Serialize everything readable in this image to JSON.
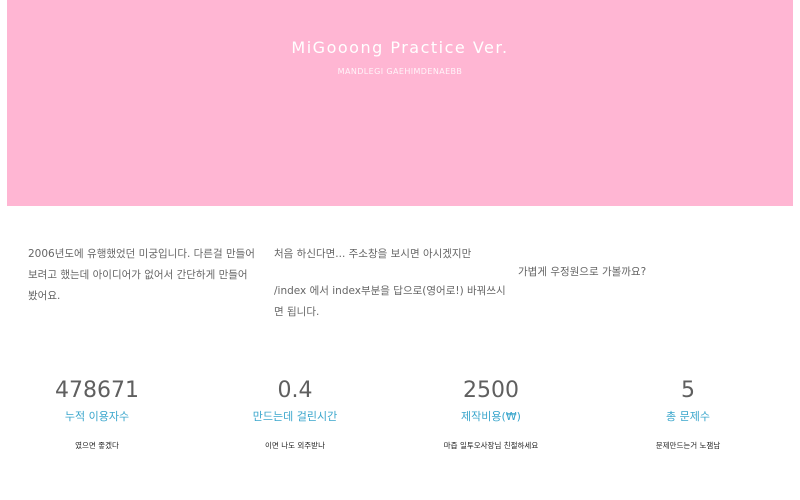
{
  "hero": {
    "title": "MiGooong Practice Ver.",
    "subtitle": "MANDLEGI GAEHIMDENAEBB"
  },
  "intro": {
    "col1": "2006년도에 유행했었던 미궁입니다. 다른걸 만들어보려고 했는데 아이디어가 없어서 간단하게 만들어봤어요.",
    "col2_p1": "처음 하신다면... 주소창을 보시면 아시겠지만",
    "col2_p2": "/index 에서 index부분을 답으로(영어로!) 바꿔쓰시면 됩니다.",
    "col3": "가볍게 우정원으로 가볼까요?"
  },
  "stats": [
    {
      "value": "478671",
      "label": "누적 이용자수",
      "note": "였으면 좋겠다"
    },
    {
      "value": "0.4",
      "label": "만드는데 걸린시간",
      "note": "이면 나도 외주받나"
    },
    {
      "value": "2500",
      "label": "제작비용(₩)",
      "note": "마즙 일투오사장님 친절하세요"
    },
    {
      "value": "5",
      "label": "총 문제수",
      "note": "문제만드는거 노잼남"
    }
  ]
}
